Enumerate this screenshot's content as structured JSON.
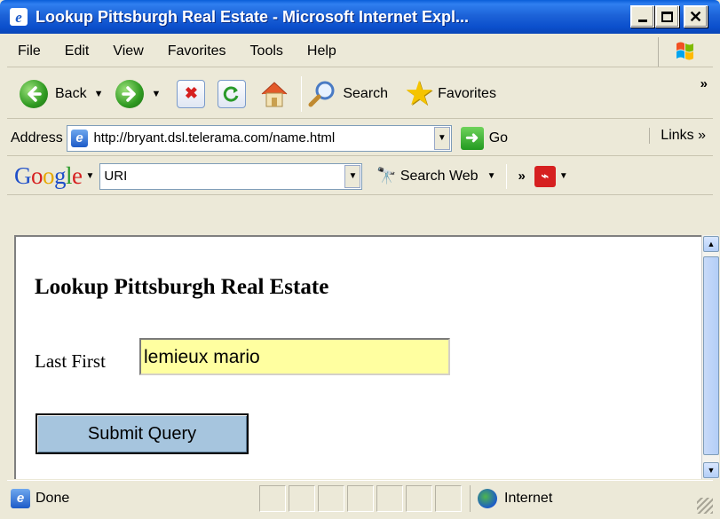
{
  "window": {
    "title": "Lookup Pittsburgh Real Estate - Microsoft Internet Expl...",
    "minimize_glyph": "",
    "close_glyph": "✕"
  },
  "menu": {
    "items": [
      "File",
      "Edit",
      "View",
      "Favorites",
      "Tools",
      "Help"
    ]
  },
  "toolbar": {
    "back_label": "Back",
    "search_label": "Search",
    "favorites_label": "Favorites",
    "overflow": "»"
  },
  "address": {
    "label": "Address",
    "url": "http://bryant.dsl.telerama.com/name.html",
    "go_label": "Go",
    "links_label": "Links »"
  },
  "google_bar": {
    "logo": [
      "G",
      "o",
      "o",
      "g",
      "l",
      "e"
    ],
    "search_value": "URI",
    "search_web_label": "Search Web",
    "overflow": "»"
  },
  "page": {
    "heading": "Lookup Pittsburgh Real Estate",
    "field_label": "Last First",
    "name_value": "lemieux mario",
    "submit_label": "Submit Query"
  },
  "status": {
    "text": "Done",
    "zone": "Internet"
  },
  "colors": {
    "titlebar": "#0b4fcc",
    "input_highlight": "#ffffa0",
    "submit_button": "#a6c5de"
  }
}
